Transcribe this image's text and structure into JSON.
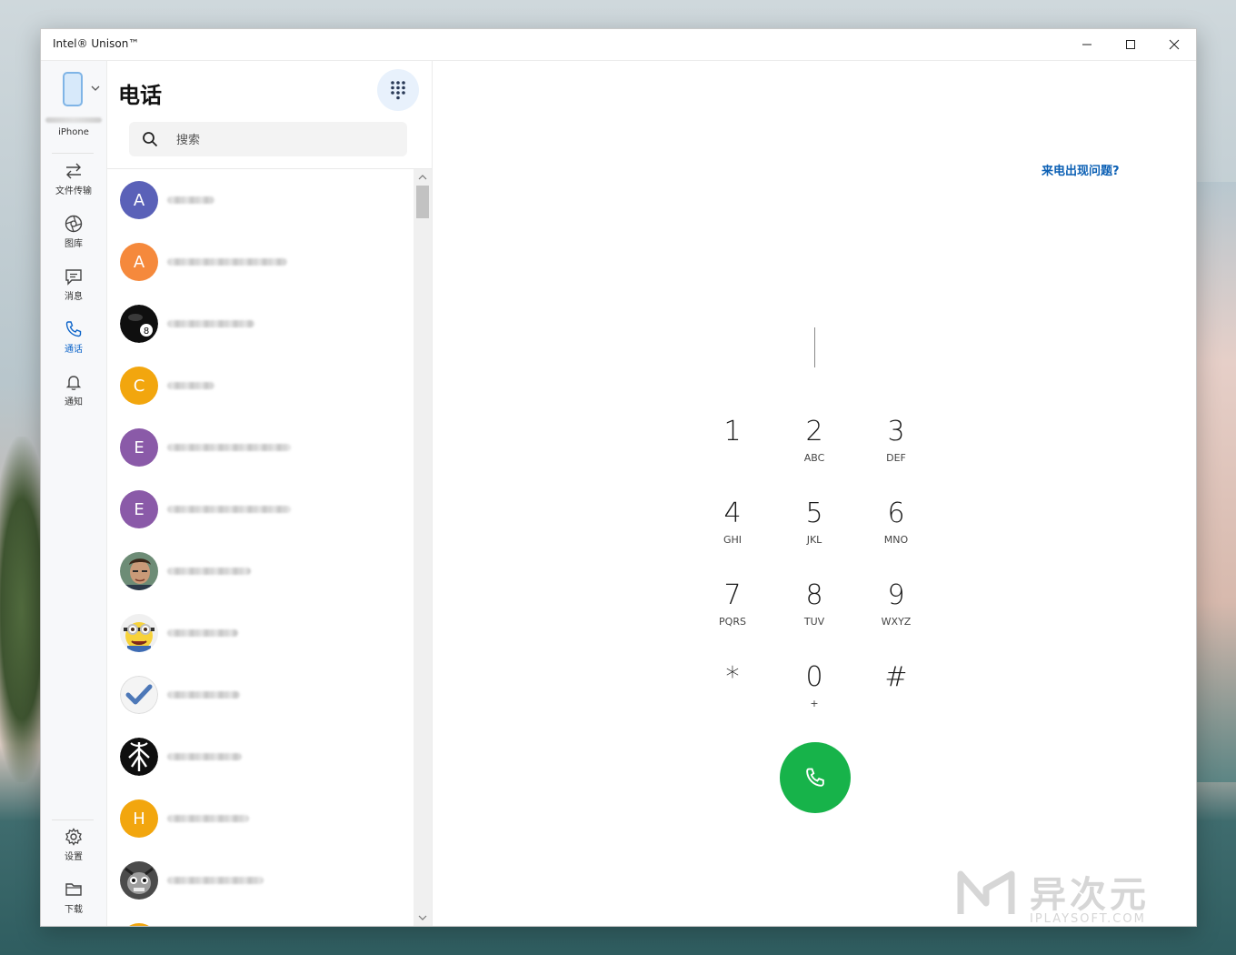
{
  "window": {
    "title": "Intel® Unison™"
  },
  "device": {
    "label": "iPhone"
  },
  "nav": [
    {
      "label": "文件传输",
      "icon": "transfer-icon"
    },
    {
      "label": "图库",
      "icon": "gallery-icon"
    },
    {
      "label": "消息",
      "icon": "message-icon"
    },
    {
      "label": "通话",
      "icon": "phone-icon",
      "active": true
    },
    {
      "label": "通知",
      "icon": "bell-icon"
    }
  ],
  "nav_bottom": [
    {
      "label": "设置",
      "icon": "gear-icon"
    },
    {
      "label": "下载",
      "icon": "folder-icon"
    }
  ],
  "calls": {
    "title": "电话",
    "search_placeholder": "搜索"
  },
  "contacts": [
    {
      "initial": "A",
      "color": "#5a61b8"
    },
    {
      "initial": "A",
      "color": "#f5893c"
    },
    {
      "initial": "",
      "avatar": "eight-ball"
    },
    {
      "initial": "C",
      "color": "#f2a60e"
    },
    {
      "initial": "E",
      "color": "#8a5aa8"
    },
    {
      "initial": "E",
      "color": "#8a5aa8"
    },
    {
      "initial": "",
      "avatar": "photo-man"
    },
    {
      "initial": "",
      "avatar": "minion"
    },
    {
      "initial": "",
      "avatar": "checkmark"
    },
    {
      "initial": "",
      "avatar": "logo-black"
    },
    {
      "initial": "H",
      "color": "#f2a60e"
    },
    {
      "initial": "",
      "avatar": "photo-dark"
    }
  ],
  "dialer": {
    "help_link": "来电出现问题?",
    "keys": [
      {
        "digit": "1",
        "letters": ""
      },
      {
        "digit": "2",
        "letters": "ABC"
      },
      {
        "digit": "3",
        "letters": "DEF"
      },
      {
        "digit": "4",
        "letters": "GHI"
      },
      {
        "digit": "5",
        "letters": "JKL"
      },
      {
        "digit": "6",
        "letters": "MNO"
      },
      {
        "digit": "7",
        "letters": "PQRS"
      },
      {
        "digit": "8",
        "letters": "TUV"
      },
      {
        "digit": "9",
        "letters": "WXYZ"
      },
      {
        "digit": "*",
        "letters": ""
      },
      {
        "digit": "0",
        "letters": "+"
      },
      {
        "digit": "#",
        "letters": ""
      }
    ],
    "call_color": "#17b34a"
  },
  "watermark": {
    "cn": "异次元",
    "en": "IPLAYSOFT.COM"
  },
  "colors": {
    "accent": "#0b63c9",
    "call": "#17b34a"
  }
}
